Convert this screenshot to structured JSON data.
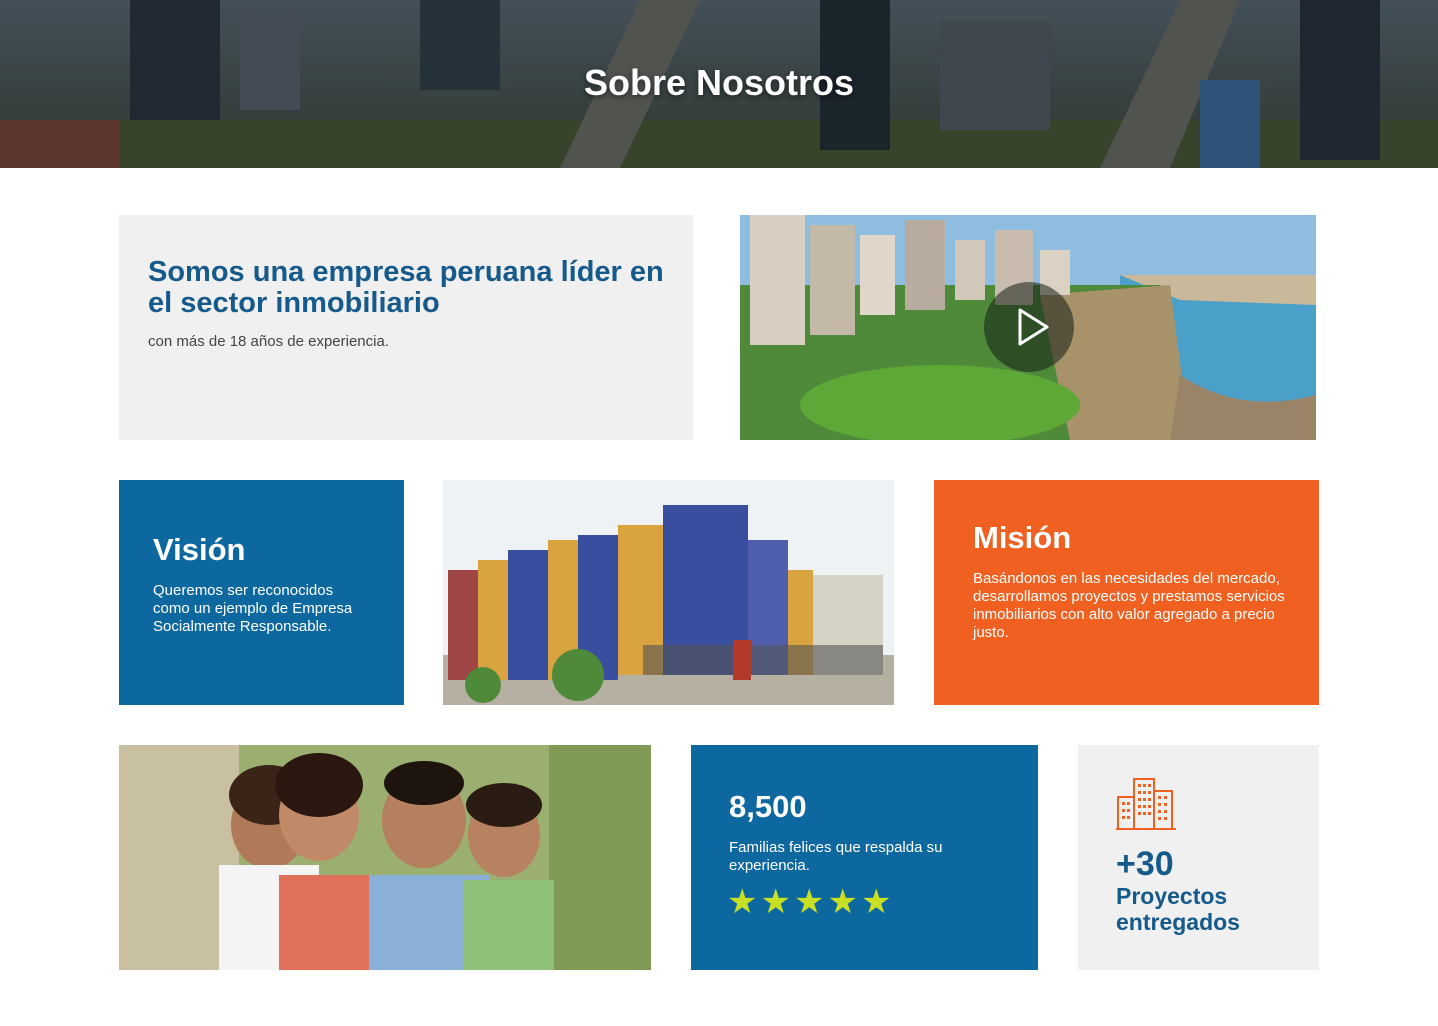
{
  "hero": {
    "title": "Sobre Nosotros"
  },
  "intro": {
    "title": "Somos una empresa peruana líder en el sector inmobiliario",
    "subtitle": "con más de 18 años de experiencia."
  },
  "video": {
    "icon": "play-icon"
  },
  "vision": {
    "title": "Visión",
    "text": "Queremos ser reconocidos como un ejemplo de Empresa Socialmente Responsable."
  },
  "mision": {
    "title": "Misión",
    "text": "Basándonos en las necesidades del mercado, desarrollamos proyectos y prestamos servicios inmobiliarios con alto valor agregado a precio justo."
  },
  "stats": {
    "number": "8,500",
    "text": "Familias felices que respalda su experiencia.",
    "rating": 5,
    "star_glyph": "★"
  },
  "projects": {
    "icon": "buildings-icon",
    "number": "+30",
    "label": "Proyectos entregados"
  },
  "colors": {
    "primary_blue": "#0e68a0",
    "heading_blue": "#155a8a",
    "orange": "#f06020",
    "light_gray": "#f0f0f0",
    "star_green": "#c8e024"
  }
}
